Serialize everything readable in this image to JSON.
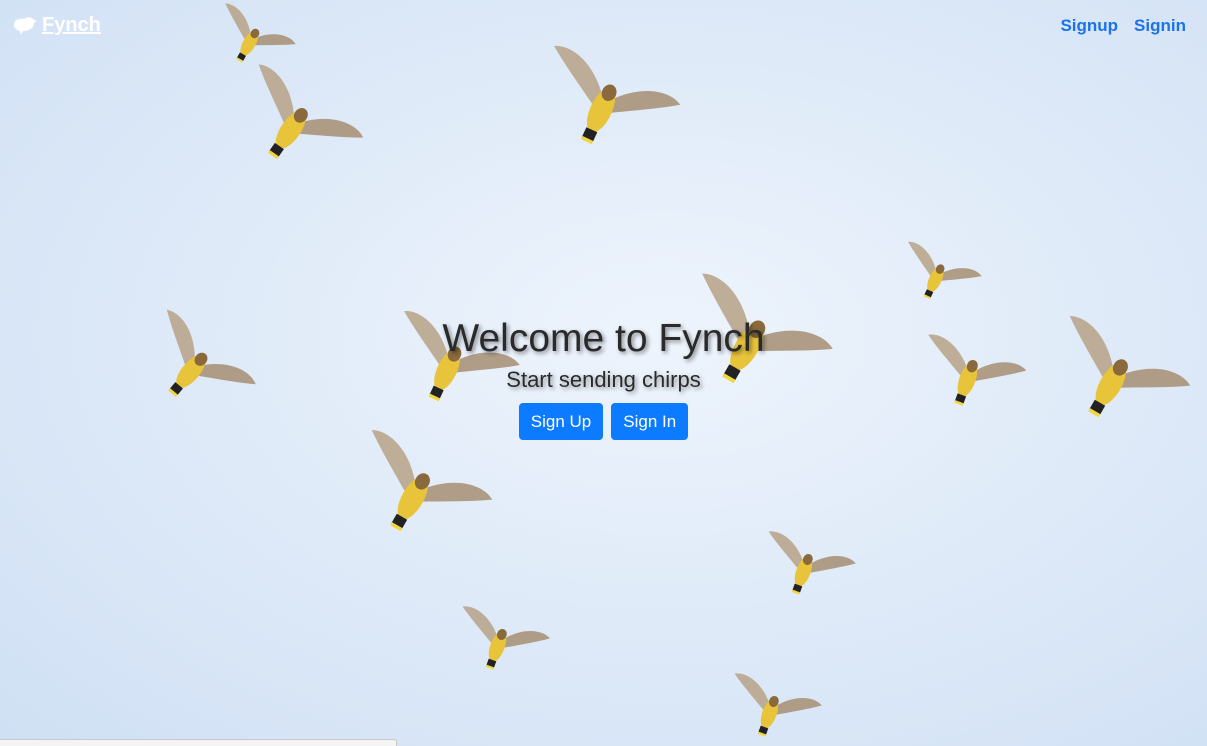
{
  "brand": {
    "name": "Fynch",
    "icon": "bird-icon"
  },
  "nav": {
    "signup_label": "Signup",
    "signin_label": "Signin"
  },
  "hero": {
    "title": "Welcome to Fynch",
    "subtitle": "Start sending chirps",
    "signup_button": "Sign Up",
    "signin_button": "Sign In"
  },
  "colors": {
    "accent": "#0d7bff",
    "nav_link": "#1a73e8",
    "sky": "#dde9f8",
    "bird_body": "#e8c43a"
  }
}
